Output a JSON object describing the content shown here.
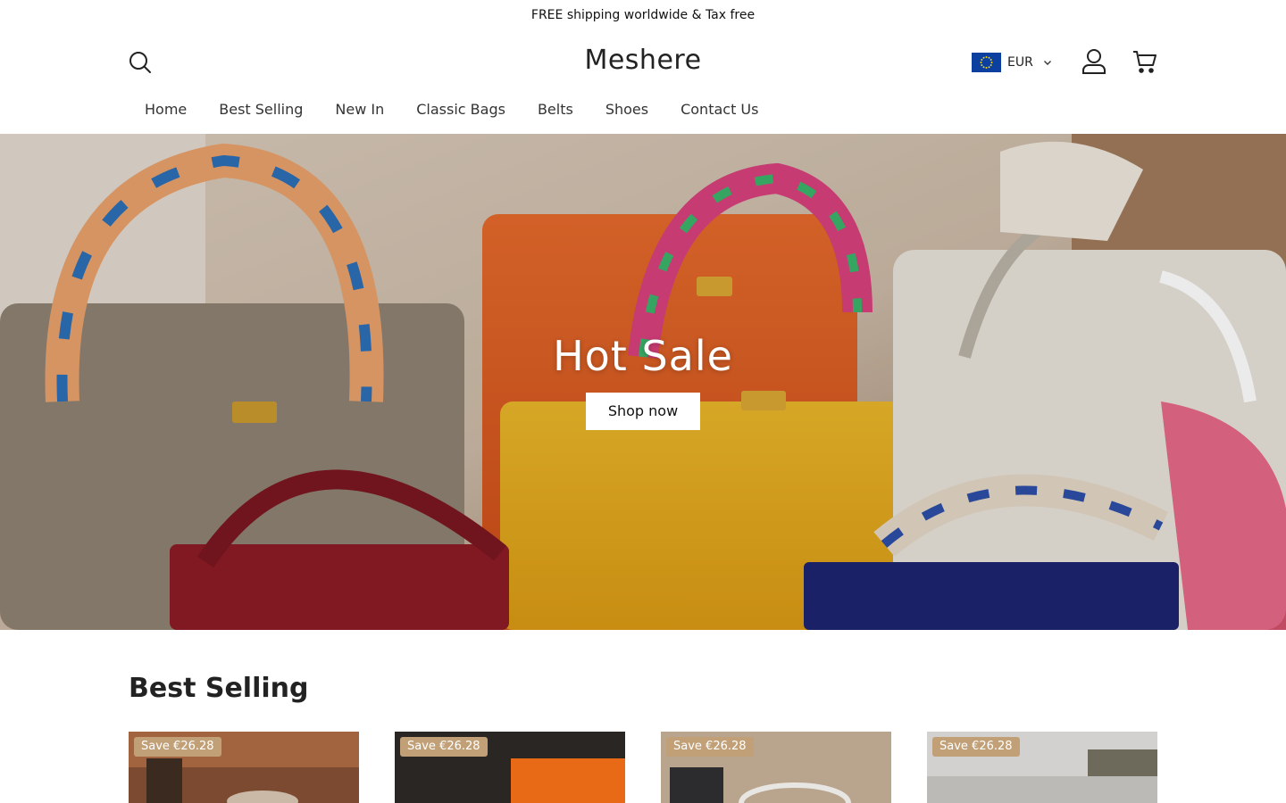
{
  "announcement": {
    "text": "FREE shipping worldwide & Tax free"
  },
  "header": {
    "logo": "Meshere",
    "currency": {
      "code": "EUR",
      "flag": "eu-flag"
    },
    "icons": {
      "search": "search-icon",
      "account": "user-icon",
      "cart": "cart-icon"
    }
  },
  "nav": {
    "items": [
      {
        "label": "Home"
      },
      {
        "label": "Best Selling"
      },
      {
        "label": "New In"
      },
      {
        "label": "Classic Bags"
      },
      {
        "label": "Belts"
      },
      {
        "label": "Shoes"
      },
      {
        "label": "Contact Us"
      }
    ]
  },
  "hero": {
    "title": "Hot Sale",
    "button": "Shop now"
  },
  "best_selling": {
    "title": "Best Selling",
    "products": [
      {
        "badge": "Save €26.28"
      },
      {
        "badge": "Save €26.28"
      },
      {
        "badge": "Save €26.28"
      },
      {
        "badge": "Save €26.28"
      }
    ]
  },
  "colors": {
    "badge": "#c2a077",
    "hero_button_bg": "#ffffff",
    "text": "#222222"
  }
}
